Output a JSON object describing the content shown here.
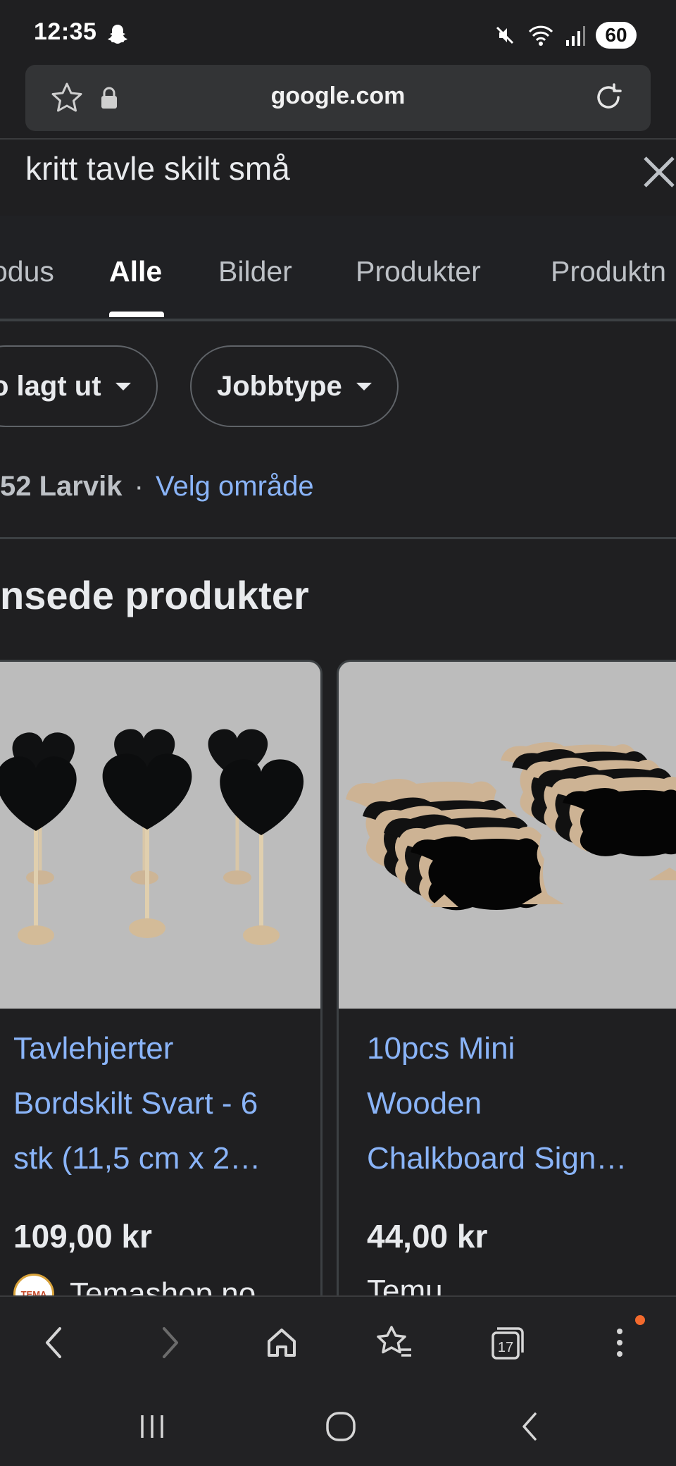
{
  "status_bar": {
    "time": "12:35",
    "battery": "60",
    "icons": [
      "snapchat-icon",
      "mute-icon",
      "wifi-icon",
      "signal-icon"
    ]
  },
  "url_bar": {
    "domain": "google.com",
    "icons": [
      "star-icon",
      "lock-icon",
      "reload-icon"
    ]
  },
  "search": {
    "query": "kritt tavle skilt små"
  },
  "tabs": [
    {
      "label": "odus",
      "active": false
    },
    {
      "label": "Alle",
      "active": true
    },
    {
      "label": "Bilder",
      "active": false
    },
    {
      "label": "Produkter",
      "active": false
    },
    {
      "label": "Produktn",
      "active": false
    }
  ],
  "chips": [
    {
      "label": "o lagt ut"
    },
    {
      "label": "Jobbtype"
    }
  ],
  "location": {
    "place": "52 Larvik",
    "separator": "·",
    "link": "Velg område"
  },
  "section": {
    "title": "nsede produkter"
  },
  "products": [
    {
      "title_lines": [
        "Tavlehjerter",
        "Bordskilt Svart - 6",
        "stk (11,5 cm x 2…"
      ],
      "price": "109,00 kr",
      "seller": "Temashop.no",
      "seller_logo_text": "TEMA"
    },
    {
      "title_lines": [
        "10pcs Mini",
        "Wooden",
        "Chalkboard Sign…"
      ],
      "price": "44,00 kr",
      "seller": "Temu"
    }
  ],
  "bottom_nav": {
    "tab_count": "17",
    "icons": [
      "back-icon",
      "forward-icon",
      "home-icon",
      "bookmarks-icon",
      "tabs-icon",
      "menu-icon"
    ]
  },
  "colors": {
    "background": "#1f1f21",
    "link": "#8ab4f8",
    "text": "#e8eaed",
    "notification": "#f36a2d"
  }
}
